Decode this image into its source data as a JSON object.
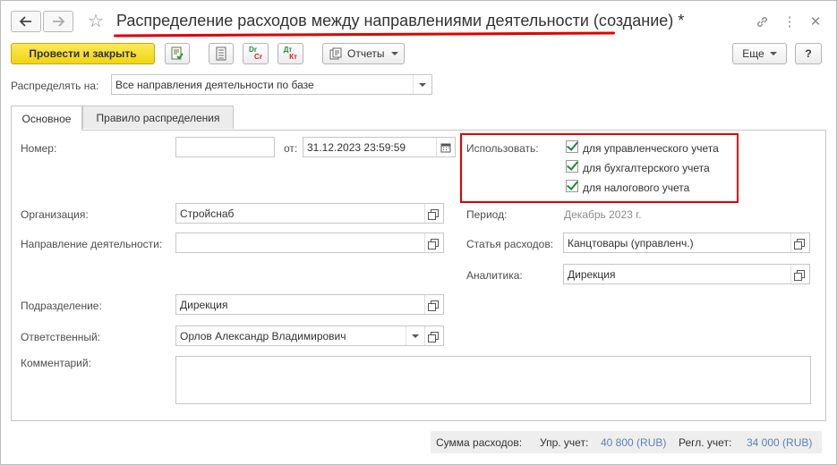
{
  "window": {
    "title": "Распределение расходов между направлениями деятельности (создание) *"
  },
  "toolbar": {
    "post_close_label": "Провести и закрыть",
    "icon_dr_top": "Dr",
    "icon_dr_bottom": "Cr",
    "icon_dt_top": "Дт",
    "icon_dt_bottom": "Кт",
    "reports_label": "Отчеты",
    "more_label": "Еще",
    "help_label": "?"
  },
  "distribute": {
    "label": "Распределять на:",
    "value": "Все направления деятельности по базе"
  },
  "tabs": [
    {
      "label": "Основное",
      "active": true
    },
    {
      "label": "Правило распределения",
      "active": false
    }
  ],
  "form": {
    "number_label": "Номер:",
    "number_value": "",
    "date_from_label": "от:",
    "date_value": "31.12.2023 23:59:59",
    "use_label": "Использовать:",
    "use_options": [
      {
        "label": "для управленческого учета",
        "checked": true
      },
      {
        "label": "для бухгалтерского учета",
        "checked": true
      },
      {
        "label": "для налогового учета",
        "checked": true
      }
    ],
    "organization_label": "Организация:",
    "organization_value": "Стройснаб",
    "period_label": "Период:",
    "period_value": "Декабрь 2023 г.",
    "activity_label": "Направление деятельности:",
    "activity_value": "",
    "expense_item_label": "Статья расходов:",
    "expense_item_value": "Канцтовары (управленч.)",
    "analytics_label": "Аналитика:",
    "analytics_value": "Дирекция",
    "department_label": "Подразделение:",
    "department_value": "Дирекция",
    "responsible_label": "Ответственный:",
    "responsible_value": "Орлов Александр Владимирович",
    "comment_label": "Комментарий:",
    "comment_value": ""
  },
  "footer": {
    "sum_label": "Сумма расходов:",
    "mgmt_label": "Упр. учет:",
    "mgmt_value": "40 800 (RUB)",
    "reg_label": "Регл. учет:",
    "reg_value": "34 000 (RUB)"
  },
  "colors": {
    "primary_button": "#f2d40f",
    "highlight_red": "#e00000",
    "checkmark": "#1a8a3a",
    "link": "#5b82b5"
  }
}
